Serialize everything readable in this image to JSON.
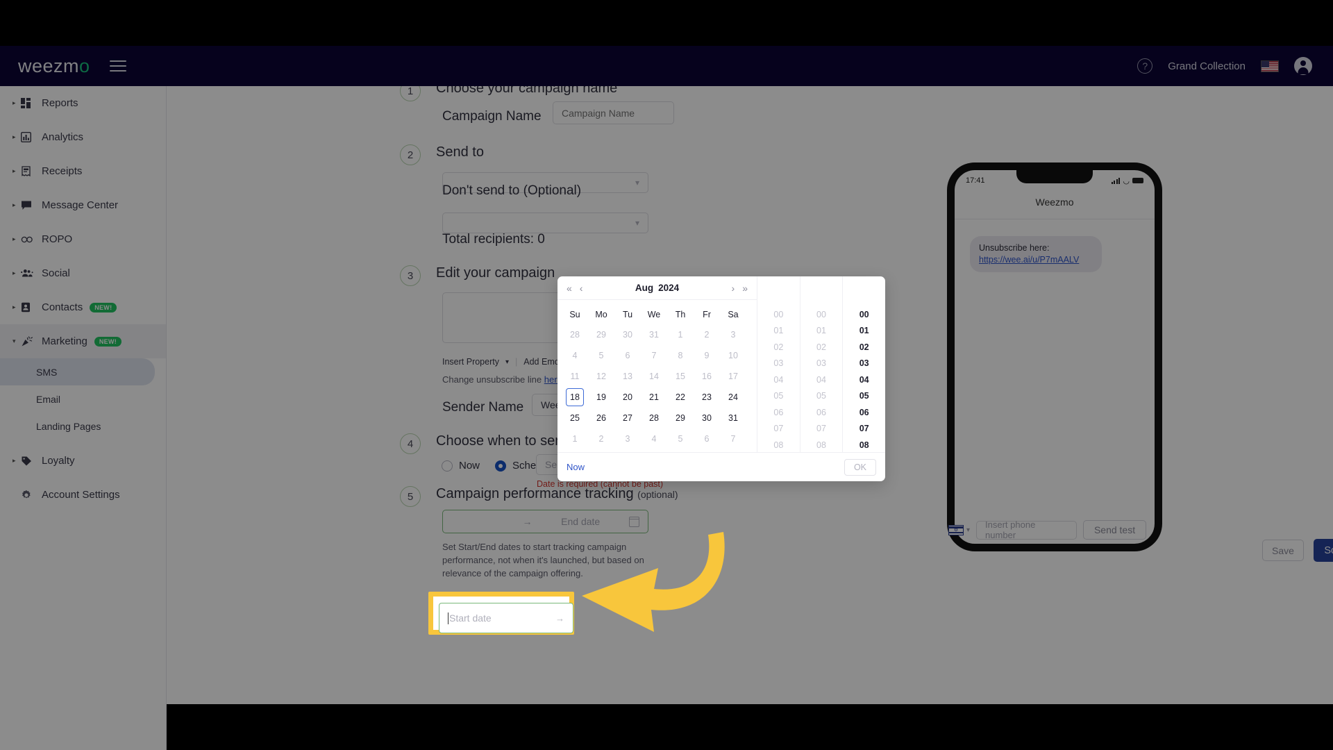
{
  "topbar": {
    "logo_text": "weezm",
    "logo_mark": "o",
    "account_name": "Grand Collection",
    "help_icon": "question-mark-circle-icon",
    "flag_icon": "us-flag-icon",
    "avatar_icon": "user-avatar-icon",
    "menu_icon": "hamburger-menu-icon"
  },
  "sidebar": {
    "items": [
      {
        "label": "Reports",
        "icon": "dashboard-grid-icon",
        "badge": ""
      },
      {
        "label": "Analytics",
        "icon": "bar-chart-icon",
        "badge": ""
      },
      {
        "label": "Receipts",
        "icon": "receipt-icon",
        "badge": ""
      },
      {
        "label": "Message Center",
        "icon": "chat-bubble-icon",
        "badge": ""
      },
      {
        "label": "ROPO",
        "icon": "infinity-icon",
        "badge": ""
      },
      {
        "label": "Social",
        "icon": "people-group-icon",
        "badge": ""
      },
      {
        "label": "Contacts",
        "icon": "contact-card-icon",
        "badge": "NEW!"
      },
      {
        "label": "Marketing",
        "icon": "party-popper-icon",
        "badge": "NEW!"
      }
    ],
    "marketing_children": [
      {
        "label": "SMS",
        "active": true
      },
      {
        "label": "Email",
        "active": false
      },
      {
        "label": "Landing Pages",
        "active": false
      }
    ],
    "loyalty": {
      "label": "Loyalty",
      "icon": "tag-icon"
    },
    "account_settings": {
      "label": "Account Settings",
      "icon": "gear-icon"
    }
  },
  "form": {
    "step1": {
      "number": "1",
      "title": "Choose your campaign name",
      "field_label": "Campaign Name",
      "field_placeholder": "Campaign Name",
      "field_value": ""
    },
    "step2": {
      "number": "2",
      "title": "Send to",
      "send_to_value": "",
      "dont_send_label": "Don't send to (Optional)",
      "dont_send_value": "",
      "total_recipients": "Total recipients: 0"
    },
    "step3": {
      "number": "3",
      "title": "Edit your campaign",
      "message_value": "",
      "insert_property": "Insert Property",
      "add_emoji": "Add Emoji",
      "unsubscribe_text": "Change unsubscribe line",
      "unsubscribe_link": "here",
      "sender_name_label": "Sender Name",
      "sender_name_value": "Weezmo"
    },
    "step4": {
      "number": "4",
      "title": "Choose when to send",
      "option_now": "Now",
      "option_schedule": "Schedule",
      "selected": "Schedule",
      "date_placeholder": "Select date",
      "date_value": "",
      "error": "Date is required (cannot be past)"
    },
    "step5": {
      "number": "5",
      "title": "Campaign performance tracking",
      "optional": "(optional)",
      "start_placeholder": "Start date",
      "start_value": "",
      "range_separator": "→",
      "end_placeholder": "End date",
      "end_value": "",
      "help_text": "Set Start/End dates to start tracking campaign performance, not when it's launched, but based on relevance of the campaign offering."
    }
  },
  "preview": {
    "status_time": "17:41",
    "title": "Weezmo",
    "message_text": "Unsubscribe here:",
    "message_link": "https://wee.ai/u/P7mAALV",
    "phone_country_flag": "israel-flag-icon",
    "phone_placeholder": "Insert phone number",
    "send_test_label": "Send test"
  },
  "footer": {
    "save_label": "Save",
    "schedule_label": "Schedule campaign"
  },
  "picker": {
    "month": "Aug",
    "year": "2024",
    "prev_year_icon": "double-chevron-left-icon",
    "prev_month_icon": "chevron-left-icon",
    "next_month_icon": "chevron-right-icon",
    "next_year_icon": "double-chevron-right-icon",
    "weekdays": [
      "Su",
      "Mo",
      "Tu",
      "We",
      "Th",
      "Fr",
      "Sa"
    ],
    "weeks": [
      [
        {
          "d": "28",
          "dim": true
        },
        {
          "d": "29",
          "dim": true
        },
        {
          "d": "30",
          "dim": true
        },
        {
          "d": "31",
          "dim": true
        },
        {
          "d": "1",
          "dim": true
        },
        {
          "d": "2",
          "dim": true
        },
        {
          "d": "3",
          "dim": true
        }
      ],
      [
        {
          "d": "4",
          "dim": true
        },
        {
          "d": "5",
          "dim": true
        },
        {
          "d": "6",
          "dim": true
        },
        {
          "d": "7",
          "dim": true
        },
        {
          "d": "8",
          "dim": true
        },
        {
          "d": "9",
          "dim": true
        },
        {
          "d": "10",
          "dim": true
        }
      ],
      [
        {
          "d": "11",
          "dim": true
        },
        {
          "d": "12",
          "dim": true
        },
        {
          "d": "13",
          "dim": true
        },
        {
          "d": "14",
          "dim": true
        },
        {
          "d": "15",
          "dim": true
        },
        {
          "d": "16",
          "dim": true
        },
        {
          "d": "17",
          "dim": true
        }
      ],
      [
        {
          "d": "18",
          "dim": false,
          "today": true
        },
        {
          "d": "19",
          "dim": false
        },
        {
          "d": "20",
          "dim": false
        },
        {
          "d": "21",
          "dim": false
        },
        {
          "d": "22",
          "dim": false
        },
        {
          "d": "23",
          "dim": false
        },
        {
          "d": "24",
          "dim": false
        }
      ],
      [
        {
          "d": "25",
          "dim": false
        },
        {
          "d": "26",
          "dim": false
        },
        {
          "d": "27",
          "dim": false
        },
        {
          "d": "28",
          "dim": false
        },
        {
          "d": "29",
          "dim": false
        },
        {
          "d": "30",
          "dim": false
        },
        {
          "d": "31",
          "dim": false
        }
      ],
      [
        {
          "d": "1",
          "dim": true
        },
        {
          "d": "2",
          "dim": true
        },
        {
          "d": "3",
          "dim": true
        },
        {
          "d": "4",
          "dim": true
        },
        {
          "d": "5",
          "dim": true
        },
        {
          "d": "6",
          "dim": true
        },
        {
          "d": "7",
          "dim": true
        }
      ]
    ],
    "hours": [
      "00",
      "01",
      "02",
      "03",
      "04",
      "05",
      "06",
      "07",
      "08"
    ],
    "minutes": [
      "00",
      "01",
      "02",
      "03",
      "04",
      "05",
      "06",
      "07",
      "08"
    ],
    "seconds": [
      "00",
      "01",
      "02",
      "03",
      "04",
      "05",
      "06",
      "07",
      "08"
    ],
    "now_label": "Now",
    "ok_label": "OK"
  },
  "annotation": {
    "arrow_color": "#f8c63c",
    "highlight_color": "#f8c63c",
    "highlight_target": "start-date-input"
  }
}
